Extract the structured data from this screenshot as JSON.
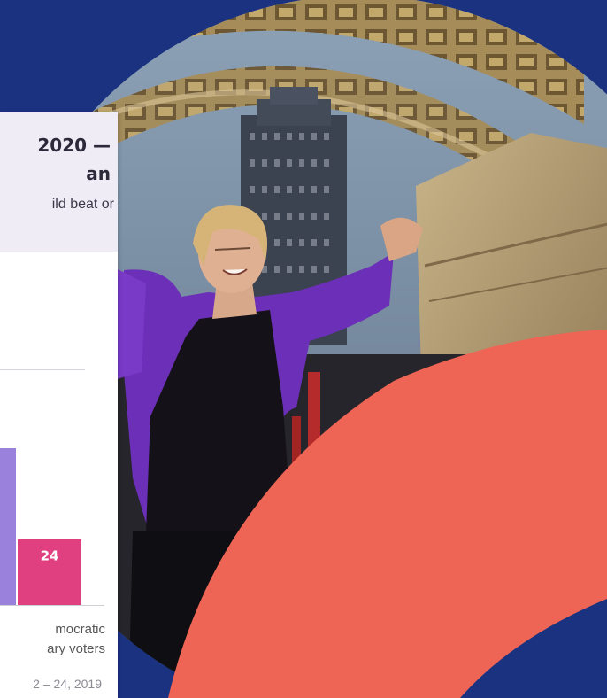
{
  "card": {
    "title_line1": "2020 —",
    "title_line2": "an",
    "subtitle": "ild beat or",
    "category_line1": "mocratic",
    "category_line2": "ary voters",
    "footnote": "2 – 24, 2019"
  },
  "chart_data": {
    "type": "bar",
    "categories": [
      "",
      ""
    ],
    "series": [
      {
        "values": [
          null,
          24
        ],
        "colors": [
          "#9a82dc",
          "#e0407f"
        ]
      }
    ],
    "data_labels": [
      "",
      "24"
    ],
    "title": "2020 — an",
    "subtitle": "ild beat or",
    "xlabel": "mocratic ary voters"
  },
  "colors": {
    "background": "#1b3280",
    "coral": "#ef6555",
    "purple_bar": "#9a82dc",
    "pink_bar": "#e0407f",
    "card_header": "#efecf6"
  }
}
